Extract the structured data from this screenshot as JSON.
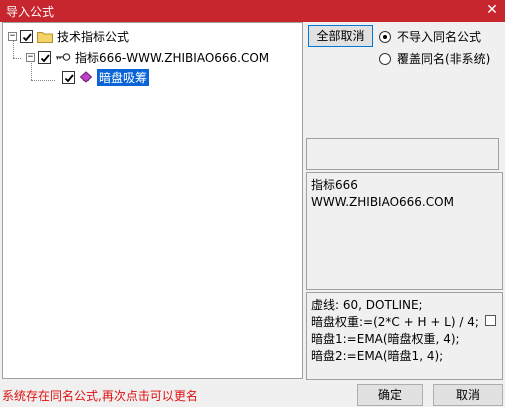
{
  "window": {
    "title": "导入公式",
    "close_glyph": "✕"
  },
  "tree": {
    "root": {
      "label": "技术指标公式",
      "expander": "−",
      "checked": true
    },
    "group": {
      "label": "指标666-WWW.ZHIBIAO666.COM",
      "expander": "−",
      "checked": true
    },
    "item": {
      "label": "暗盘吸筹",
      "checked": true,
      "selected": true
    }
  },
  "options": {
    "toggle_all_label": "全部取消",
    "radio_skip_label": "不导入同名公式",
    "radio_overwrite_label": "覆盖同名(非系统)",
    "selected": "skip"
  },
  "info": {
    "line1": "指标666",
    "line2": "WWW.ZHIBIAO666.COM"
  },
  "code": {
    "lines": [
      "虚线: 60, DOTLINE;",
      "暗盘权重:=(2*C + H + L) / 4;",
      "暗盘1:=EMA(暗盘权重, 4);",
      "暗盘2:=EMA(暗盘1, 4);"
    ]
  },
  "status_text": "系统存在同名公式,再次点击可以更名",
  "footer": {
    "ok_label": "确定",
    "cancel_label": "取消"
  },
  "colors": {
    "titlebar": "#c8262f",
    "status": "#e01010",
    "selection": "#0a64d8"
  }
}
